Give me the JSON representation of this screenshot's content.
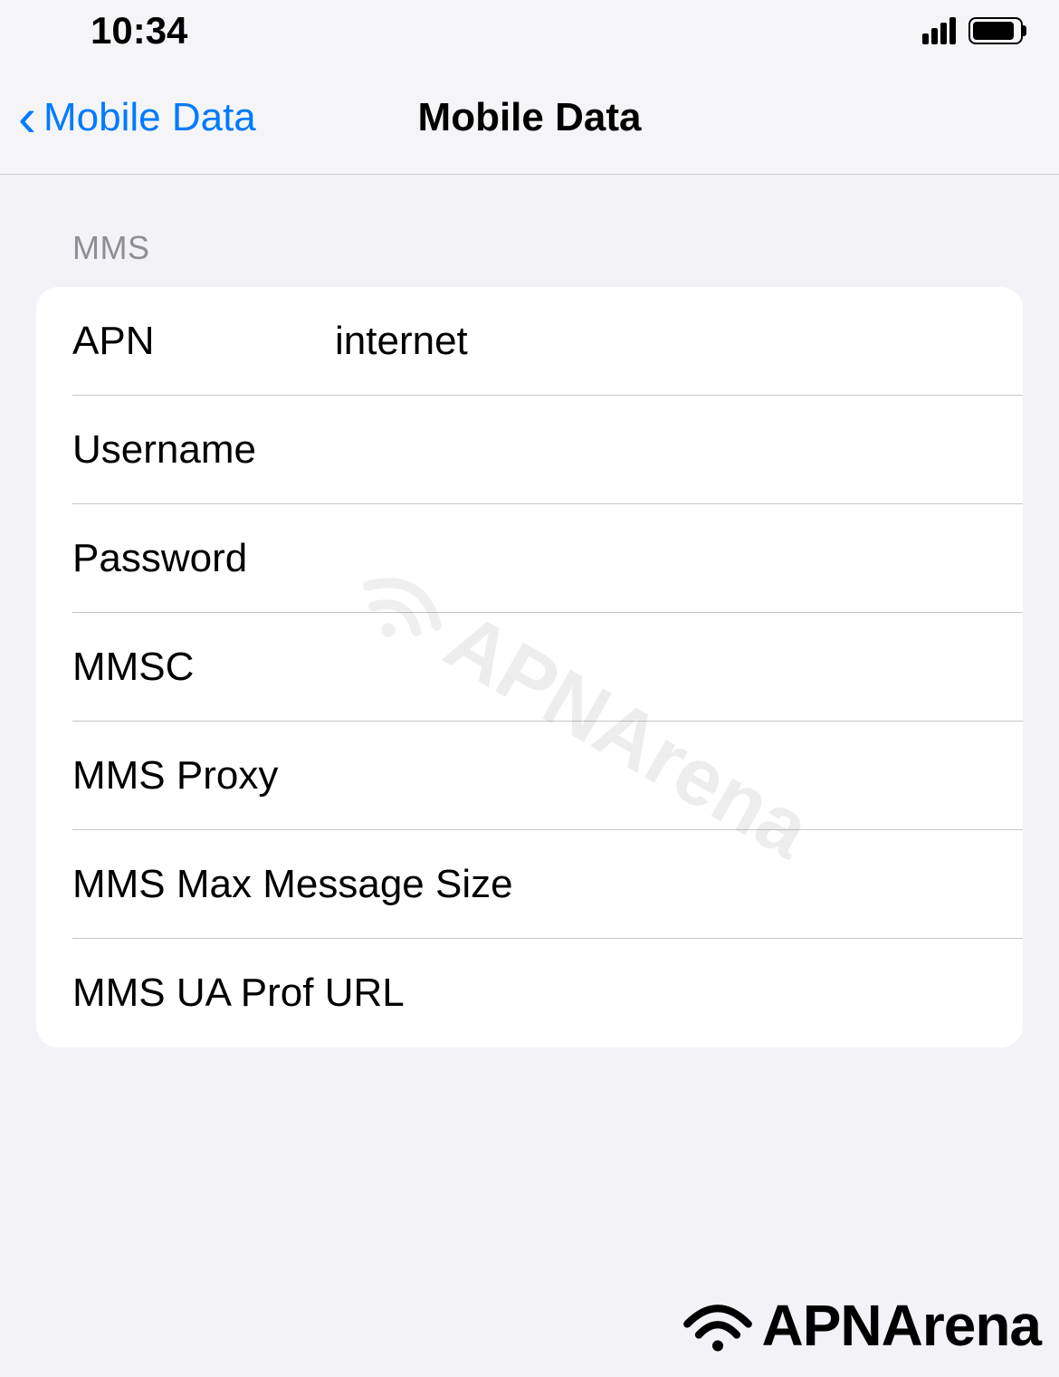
{
  "statusBar": {
    "time": "10:34"
  },
  "nav": {
    "backLabel": "Mobile Data",
    "title": "Mobile Data"
  },
  "section": {
    "header": "MMS",
    "rows": {
      "apn": {
        "label": "APN",
        "value": "internet"
      },
      "username": {
        "label": "Username",
        "value": ""
      },
      "password": {
        "label": "Password",
        "value": ""
      },
      "mmsc": {
        "label": "MMSC",
        "value": ""
      },
      "mmsProxy": {
        "label": "MMS Proxy",
        "value": ""
      },
      "mmsMaxSize": {
        "label": "MMS Max Message Size",
        "value": ""
      },
      "mmsUaProf": {
        "label": "MMS UA Prof URL",
        "value": ""
      }
    }
  },
  "watermark": "APNArena",
  "footerBrand": "APNArena"
}
